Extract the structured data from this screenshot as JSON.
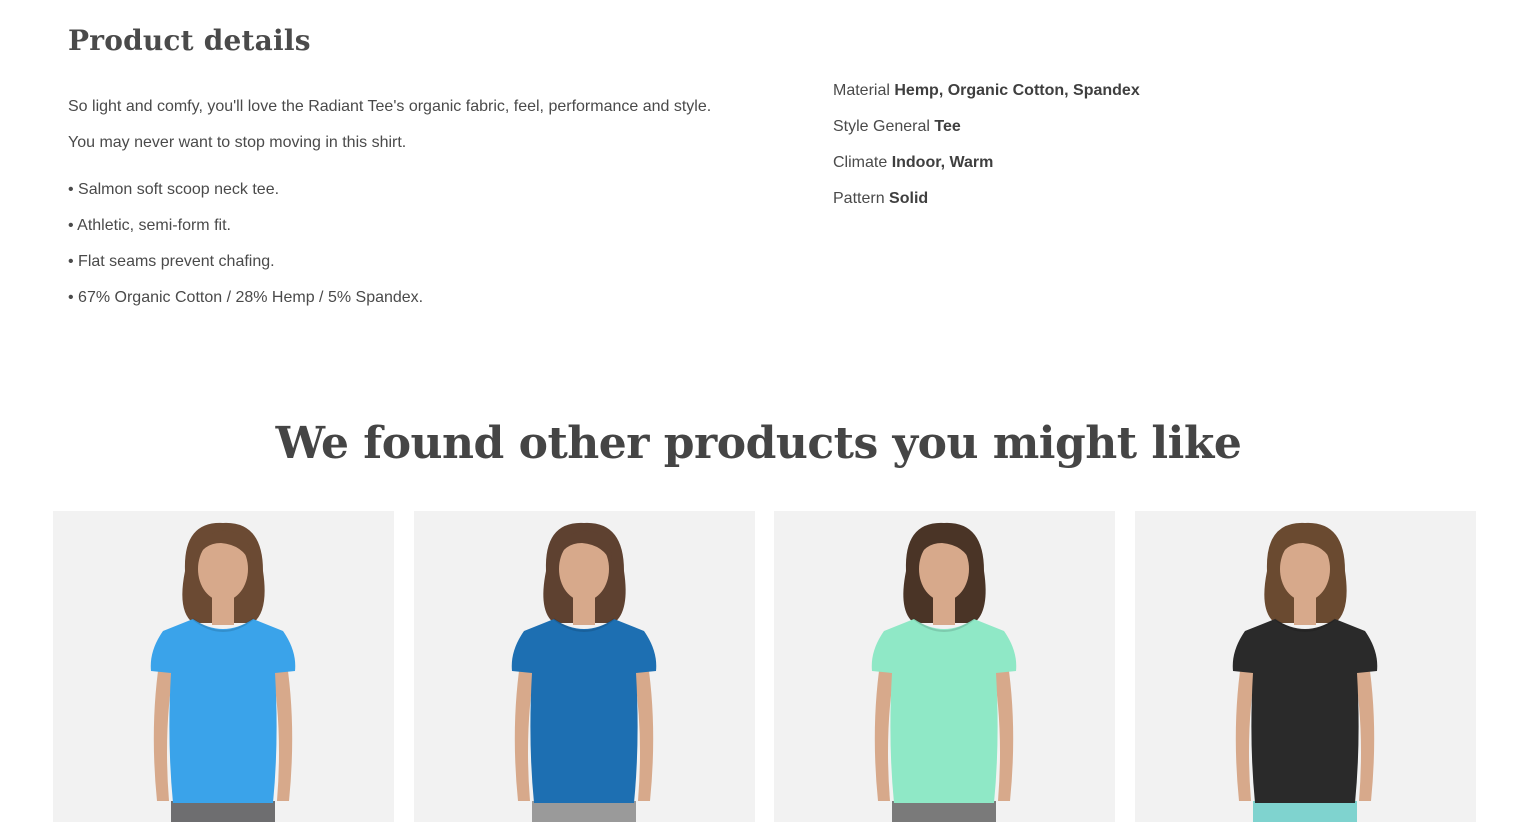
{
  "product_details": {
    "title": "Product details",
    "description": [
      "So light and comfy, you'll love the Radiant Tee's organic fabric, feel, performance and style.",
      "You may never want to stop moving in this shirt."
    ],
    "features": [
      "• Salmon soft scoop neck tee.",
      "• Athletic, semi-form fit.",
      "• Flat seams prevent chafing.",
      "• 67% Organic Cotton / 28% Hemp / 5% Spandex."
    ],
    "attributes": [
      {
        "label": "Material",
        "value": "Hemp, Organic Cotton, Spandex"
      },
      {
        "label": "Style General",
        "value": "Tee"
      },
      {
        "label": "Climate",
        "value": "Indoor, Warm"
      },
      {
        "label": "Pattern",
        "value": "Solid"
      }
    ]
  },
  "recommendations": {
    "title": "We found other products you might like",
    "products": [
      {
        "image": "woman-light-blue-scoop-tee",
        "shirt_color": "#3aa3ea",
        "hair_color": "#6b4a33",
        "bottom_color": "#6e6e70"
      },
      {
        "image": "woman-royal-blue-vneck-ruched-tee",
        "shirt_color": "#1d6fb2",
        "hair_color": "#5e4130",
        "bottom_color": "#9a9a9a"
      },
      {
        "image": "woman-mint-vneck-tee",
        "shirt_color": "#8fe8c6",
        "hair_color": "#4a3426",
        "bottom_color": "#7a7a7a"
      },
      {
        "image": "woman-black-scoop-tee",
        "shirt_color": "#2a2a2a",
        "hair_color": "#6a4a30",
        "bottom_color": "#7fd3cf"
      }
    ]
  },
  "colors": {
    "card_background": "#f2f2f2",
    "text": "#4a4a4a",
    "skin": "#d7a98b"
  }
}
